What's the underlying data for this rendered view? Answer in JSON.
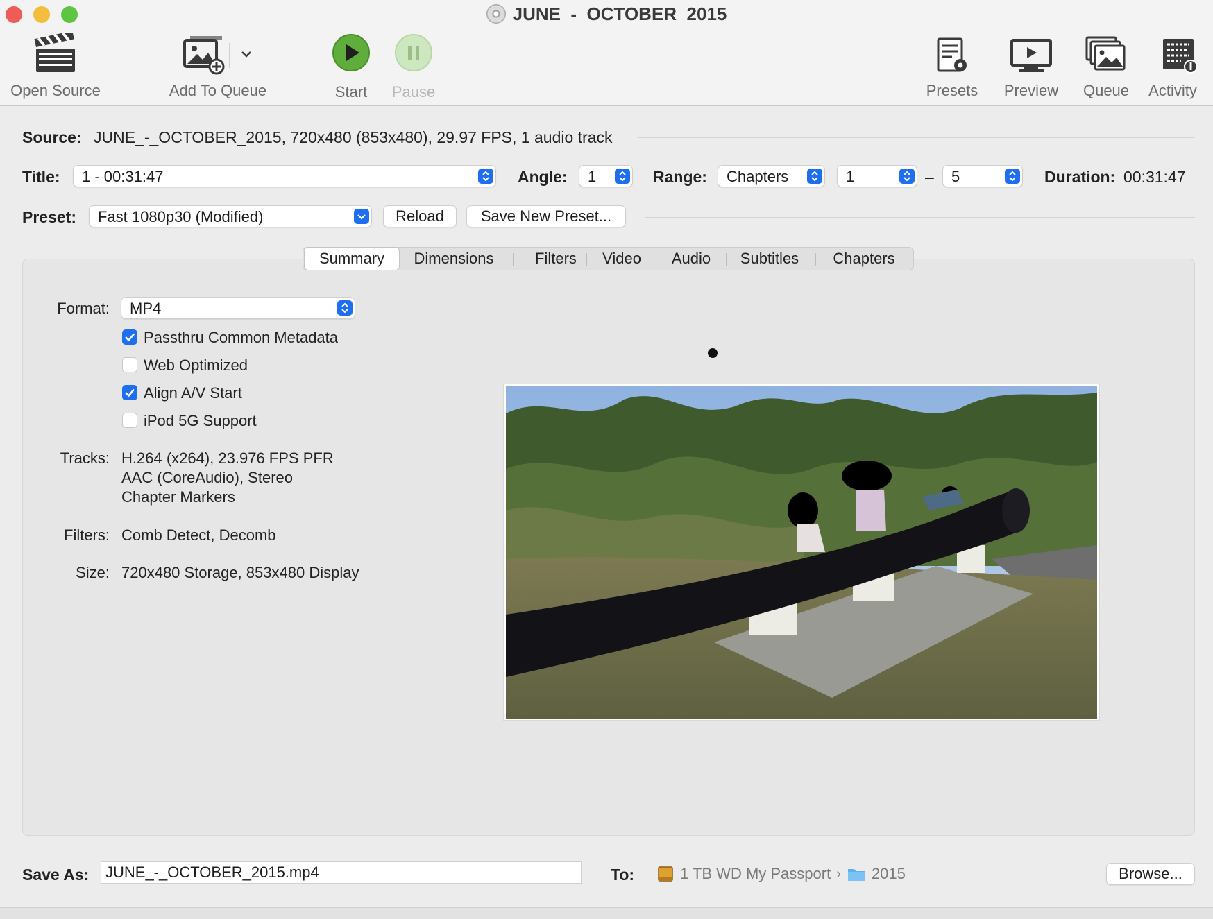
{
  "window": {
    "title": "JUNE_-_OCTOBER_2015"
  },
  "toolbar": {
    "open_source": "Open Source",
    "add_to_queue": "Add To Queue",
    "start": "Start",
    "pause": "Pause",
    "presets": "Presets",
    "preview": "Preview",
    "queue": "Queue",
    "activity": "Activity"
  },
  "source": {
    "label": "Source:",
    "value": "JUNE_-_OCTOBER_2015, 720x480 (853x480), 29.97 FPS, 1 audio track"
  },
  "title_row": {
    "title_label": "Title:",
    "title_value": "1 - 00:31:47",
    "angle_label": "Angle:",
    "angle_value": "1",
    "range_label": "Range:",
    "range_type": "Chapters",
    "range_start": "1",
    "range_dash": "–",
    "range_end": "5",
    "duration_label": "Duration:",
    "duration_value": "00:31:47"
  },
  "preset_row": {
    "label": "Preset:",
    "value": "Fast 1080p30 (Modified)",
    "reload": "Reload",
    "save_new": "Save New Preset..."
  },
  "tabs": [
    "Summary",
    "Dimensions",
    "Filters",
    "Video",
    "Audio",
    "Subtitles",
    "Chapters"
  ],
  "active_tab": "Summary",
  "summary": {
    "format_label": "Format:",
    "format_value": "MP4",
    "checkboxes": [
      {
        "label": "Passthru Common Metadata",
        "checked": true
      },
      {
        "label": "Web Optimized",
        "checked": false
      },
      {
        "label": "Align A/V Start",
        "checked": true
      },
      {
        "label": "iPod 5G Support",
        "checked": false
      }
    ],
    "tracks_label": "Tracks:",
    "tracks": [
      "H.264 (x264), 23.976 FPS PFR",
      "AAC (CoreAudio), Stereo",
      "Chapter Markers"
    ],
    "filters_label": "Filters:",
    "filters_value": "Comb Detect, Decomb",
    "size_label": "Size:",
    "size_value": "720x480 Storage, 853x480 Display"
  },
  "save_row": {
    "save_as_label": "Save As:",
    "save_as_value": "JUNE_-_OCTOBER_2015.mp4",
    "to_label": "To:",
    "drive": "1 TB WD My Passport",
    "folder": "2015",
    "browse": "Browse..."
  },
  "colors": {
    "accent": "#1d6ef0",
    "close": "#ee5d55",
    "minimize": "#f5bd3c",
    "zoom": "#5ec543",
    "start_green": "#5fae3b"
  }
}
